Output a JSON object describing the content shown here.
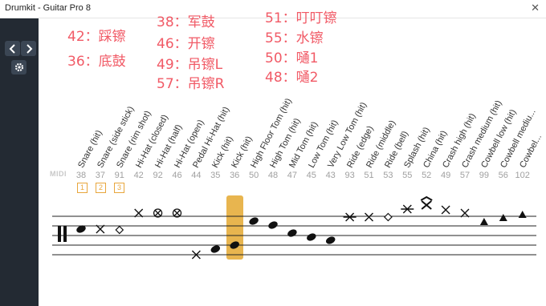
{
  "window": {
    "title": "Drumkit - Guitar Pro 8",
    "close_glyph": "✕"
  },
  "sidebar": {
    "prev_icon": "chevron-left-icon",
    "next_icon": "chevron-right-icon",
    "settings_icon": "gear-icon"
  },
  "annotations": [
    "42：踩镲",
    "36：底鼓",
    "38：军鼓",
    "46：开镲",
    "49：吊镲L",
    "57：吊镲R",
    "51：叮叮镲",
    "55：水镲",
    "50：嗵1",
    "48：嗵2"
  ],
  "colors": {
    "annotation": "#f15a66",
    "highlight": "#e8b54f",
    "sidebar": "#232a33"
  },
  "midi_label": "MIDI",
  "variant_markers": [
    "1",
    "2",
    "3"
  ],
  "instruments": [
    {
      "name": "Snare (hit)",
      "midi": "38"
    },
    {
      "name": "Snare (side stick)",
      "midi": "37"
    },
    {
      "name": "Snare (rim shot)",
      "midi": "91"
    },
    {
      "name": "Hi-Hat (closed)",
      "midi": "42"
    },
    {
      "name": "Hi-Hat (half)",
      "midi": "92"
    },
    {
      "name": "Hi-Hat (open)",
      "midi": "46"
    },
    {
      "name": "Pedal Hi-Hat (hit)",
      "midi": "44"
    },
    {
      "name": "Kick (hit)",
      "midi": "35"
    },
    {
      "name": "Kick (hit)",
      "midi": "36"
    },
    {
      "name": "High Floor Tom (hit)",
      "midi": "50"
    },
    {
      "name": "High Tom (hit)",
      "midi": "48"
    },
    {
      "name": "Mid Tom (hit)",
      "midi": "47"
    },
    {
      "name": "Low Tom (hit)",
      "midi": "45"
    },
    {
      "name": "Very Low Tom (hit)",
      "midi": "43"
    },
    {
      "name": "Ride (edge)",
      "midi": "93"
    },
    {
      "name": "Ride (middle)",
      "midi": "51"
    },
    {
      "name": "Ride (bell)",
      "midi": "53"
    },
    {
      "name": "Splash (hit)",
      "midi": "55"
    },
    {
      "name": "China (hit)",
      "midi": "52"
    },
    {
      "name": "Crash high (hit)",
      "midi": "49"
    },
    {
      "name": "Crash medium (hit)",
      "midi": "57"
    },
    {
      "name": "Cowbell low (hit)",
      "midi": "99"
    },
    {
      "name": "Cowbell mediu...",
      "midi": "56"
    },
    {
      "name": "Cowbel...",
      "midi": "102"
    }
  ]
}
